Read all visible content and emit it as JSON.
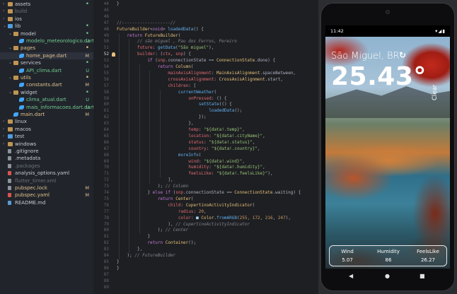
{
  "explorer": {
    "items": [
      {
        "label": "assets",
        "type": "folder",
        "depth": 0,
        "open": false,
        "status": "dot",
        "color": "green"
      },
      {
        "label": "build",
        "type": "folder",
        "depth": 0,
        "open": false,
        "status": "",
        "color": "ignored"
      },
      {
        "label": "ios",
        "type": "folder",
        "depth": 0,
        "open": false,
        "status": "",
        "color": "normal"
      },
      {
        "label": "lib",
        "type": "folder",
        "depth": 0,
        "open": true,
        "status": "dot",
        "color": "green"
      },
      {
        "label": "model",
        "type": "folder",
        "depth": 1,
        "open": true,
        "status": "dot",
        "color": "green"
      },
      {
        "label": "modelo_meteorologico.dart",
        "type": "dart",
        "depth": 2,
        "status": "U",
        "color": "untracked"
      },
      {
        "label": "pages",
        "type": "folder",
        "depth": 1,
        "open": true,
        "status": "dot",
        "color": "modified"
      },
      {
        "label": "home_page.dart",
        "type": "dart",
        "depth": 2,
        "status": "M",
        "color": "modified",
        "selected": true
      },
      {
        "label": "services",
        "type": "folder",
        "depth": 1,
        "open": true,
        "status": "dot",
        "color": "green"
      },
      {
        "label": "API_clima.dart",
        "type": "dart",
        "depth": 2,
        "status": "U",
        "color": "untracked"
      },
      {
        "label": "utils",
        "type": "folder",
        "depth": 1,
        "open": true,
        "status": "dot",
        "color": "modified"
      },
      {
        "label": "constants.dart",
        "type": "dart",
        "depth": 2,
        "status": "M",
        "color": "modified"
      },
      {
        "label": "widget",
        "type": "folder",
        "depth": 1,
        "open": true,
        "status": "dot",
        "color": "green"
      },
      {
        "label": "clima_atual.dart",
        "type": "dart",
        "depth": 2,
        "status": "U",
        "color": "untracked"
      },
      {
        "label": "mais_informacoes.dart.dart",
        "type": "dart",
        "depth": 2,
        "status": "U",
        "color": "untracked"
      },
      {
        "label": "main.dart",
        "type": "dart",
        "depth": 1,
        "status": "M",
        "color": "modified"
      },
      {
        "label": "linux",
        "type": "folder",
        "depth": 0,
        "open": false,
        "status": "",
        "color": "normal"
      },
      {
        "label": "macos",
        "type": "folder",
        "depth": 0,
        "open": false,
        "status": "",
        "color": "normal"
      },
      {
        "label": "test",
        "type": "folder",
        "depth": 0,
        "open": false,
        "status": "",
        "color": "normal"
      },
      {
        "label": "windows",
        "type": "folder",
        "depth": 0,
        "open": false,
        "status": "",
        "color": "normal"
      },
      {
        "label": ".gitignore",
        "type": "file",
        "depth": 0,
        "status": "",
        "color": "normal"
      },
      {
        "label": ".metadata",
        "type": "file",
        "depth": 0,
        "status": "",
        "color": "normal"
      },
      {
        "label": ".packages",
        "type": "file",
        "depth": 0,
        "status": "",
        "color": "ignored"
      },
      {
        "label": "analysis_options.yaml",
        "type": "yaml",
        "depth": 0,
        "status": "",
        "color": "normal"
      },
      {
        "label": "flutter_timer.xml",
        "type": "file",
        "depth": 0,
        "status": "",
        "color": "ignored"
      },
      {
        "label": "pubspec.lock",
        "type": "file",
        "depth": 0,
        "status": "M",
        "color": "modified"
      },
      {
        "label": "pubspec.yaml",
        "type": "yaml",
        "depth": 0,
        "status": "M",
        "color": "modified"
      },
      {
        "label": "README.md",
        "type": "md",
        "depth": 0,
        "status": "",
        "color": "normal"
      }
    ]
  },
  "editor": {
    "active_line": "52",
    "lines": [
      {
        "n": "44",
        "ind": 0,
        "t": [
          [
            "}",
            ""
          ]
        ]
      },
      {
        "n": "45",
        "ind": 0,
        "t": []
      },
      {
        "n": "46",
        "ind": 0,
        "t": []
      },
      {
        "n": "47",
        "ind": 0,
        "t": [
          [
            "//-------------------//",
            "cm"
          ]
        ]
      },
      {
        "n": "48",
        "ind": 0,
        "t": [
          [
            "FutureBuilder",
            "cls"
          ],
          [
            "<",
            ""
          ],
          [
            "void",
            "kw"
          ],
          [
            "> ",
            ""
          ],
          [
            "loadedData",
            "fn"
          ],
          [
            "() {",
            ""
          ]
        ]
      },
      {
        "n": "49",
        "ind": 1,
        "t": [
          [
            "return ",
            "kw"
          ],
          [
            "FutureBuilder",
            "cls"
          ],
          [
            "(",
            ""
          ]
        ]
      },
      {
        "n": "50",
        "ind": 2,
        "t": [
          [
            "// são miguel , Pau dos Ferros, Pereiro",
            "cm"
          ]
        ]
      },
      {
        "n": "51",
        "ind": 2,
        "t": [
          [
            "future",
            "prop"
          ],
          [
            ": ",
            ""
          ],
          [
            "getData",
            "fn"
          ],
          [
            "(",
            ""
          ],
          [
            "\"São miguel\"",
            "str"
          ],
          [
            "),",
            ""
          ]
        ]
      },
      {
        "n": "52",
        "ind": 2,
        "t": [
          [
            "builder",
            "prop"
          ],
          [
            ": (",
            ""
          ],
          [
            "ctx",
            "prop"
          ],
          [
            ", ",
            ""
          ],
          [
            "snp",
            "prop"
          ],
          [
            ") {",
            ""
          ]
        ],
        "bulb": true
      },
      {
        "n": "53",
        "ind": 3,
        "t": [
          [
            "if ",
            "kw"
          ],
          [
            "(",
            ""
          ],
          [
            "snp",
            "prop"
          ],
          [
            ".connectionState == ",
            ""
          ],
          [
            "ConnectionState",
            "cls"
          ],
          [
            ".done) {",
            ""
          ]
        ]
      },
      {
        "n": "54",
        "ind": 4,
        "t": [
          [
            "return ",
            "kw"
          ],
          [
            "Column",
            "cls"
          ],
          [
            "(",
            ""
          ]
        ]
      },
      {
        "n": "55",
        "ind": 5,
        "t": [
          [
            "mainAxisAlignment",
            "prop"
          ],
          [
            ": ",
            ""
          ],
          [
            "MainAxisAlignment",
            "cls"
          ],
          [
            ".spaceBetween,",
            ""
          ]
        ]
      },
      {
        "n": "56",
        "ind": 5,
        "t": [
          [
            "crossAxisAlignment",
            "prop"
          ],
          [
            ": ",
            ""
          ],
          [
            "CrossAxisAlignment",
            "cls"
          ],
          [
            ".start,",
            ""
          ]
        ]
      },
      {
        "n": "57",
        "ind": 5,
        "t": [
          [
            "children",
            "prop"
          ],
          [
            ": [",
            ""
          ]
        ]
      },
      {
        "n": "58",
        "ind": 6,
        "t": [
          [
            "currentWeather",
            "fn"
          ],
          [
            "(",
            ""
          ]
        ]
      },
      {
        "n": "59",
        "ind": 7,
        "t": [
          [
            "onPressed",
            "prop"
          ],
          [
            ": () {",
            ""
          ]
        ]
      },
      {
        "n": "60",
        "ind": 8,
        "t": [
          [
            "setState",
            "fn"
          ],
          [
            "(() {",
            ""
          ]
        ]
      },
      {
        "n": "61",
        "ind": 9,
        "t": [
          [
            "loadedData",
            "fn"
          ],
          [
            "();",
            ""
          ]
        ]
      },
      {
        "n": "62",
        "ind": 8,
        "t": [
          [
            "});",
            ""
          ]
        ]
      },
      {
        "n": "63",
        "ind": 7,
        "t": [
          [
            "},",
            ""
          ]
        ]
      },
      {
        "n": "64",
        "ind": 7,
        "t": [
          [
            "temp",
            "prop"
          ],
          [
            ": ",
            ""
          ],
          [
            "\"${data!.temp}\"",
            "str"
          ],
          [
            ",",
            ""
          ]
        ]
      },
      {
        "n": "65",
        "ind": 7,
        "t": [
          [
            "location",
            "prop"
          ],
          [
            ": ",
            ""
          ],
          [
            "\"${data!.cityName}\"",
            "str"
          ],
          [
            ",",
            ""
          ]
        ]
      },
      {
        "n": "66",
        "ind": 7,
        "t": [
          [
            "status",
            "prop"
          ],
          [
            ": ",
            ""
          ],
          [
            "\"${data!.status}\"",
            "str"
          ],
          [
            ",",
            ""
          ]
        ]
      },
      {
        "n": "67",
        "ind": 7,
        "t": [
          [
            "country",
            "prop"
          ],
          [
            ": ",
            ""
          ],
          [
            "\"${data!.country}\"",
            "str"
          ],
          [
            ",",
            ""
          ]
        ]
      },
      {
        "n": "68",
        "ind": 6,
        "t": [
          [
            "moreInfo",
            "fn"
          ],
          [
            "(",
            ""
          ]
        ]
      },
      {
        "n": "69",
        "ind": 7,
        "t": [
          [
            "wind",
            "prop"
          ],
          [
            ": ",
            ""
          ],
          [
            "\"${data!.wind}\"",
            "str"
          ],
          [
            ",",
            ""
          ]
        ]
      },
      {
        "n": "70",
        "ind": 7,
        "t": [
          [
            "humidity",
            "prop"
          ],
          [
            ": ",
            ""
          ],
          [
            "\"${data!.humidity}\"",
            "str"
          ],
          [
            ",",
            ""
          ]
        ]
      },
      {
        "n": "71",
        "ind": 7,
        "t": [
          [
            "feelsLike",
            "prop"
          ],
          [
            ": ",
            ""
          ],
          [
            "\"${data!.feelsLike}\"",
            "str"
          ],
          [
            "),",
            ""
          ]
        ]
      },
      {
        "n": "72",
        "ind": 5,
        "t": [
          [
            "],",
            ""
          ]
        ]
      },
      {
        "n": "73",
        "ind": 4,
        "t": [
          [
            "); ",
            ""
          ],
          [
            "// Column",
            "cm"
          ]
        ]
      },
      {
        "n": "74",
        "ind": 3,
        "t": [
          [
            "} ",
            ""
          ],
          [
            "else if ",
            "kw"
          ],
          [
            "(",
            ""
          ],
          [
            "snp",
            "prop"
          ],
          [
            ".connectionState == ",
            ""
          ],
          [
            "ConnectionState",
            "cls"
          ],
          [
            ".waiting) {",
            ""
          ]
        ]
      },
      {
        "n": "75",
        "ind": 4,
        "t": [
          [
            "return ",
            "kw"
          ],
          [
            "Center",
            "cls"
          ],
          [
            "(",
            ""
          ]
        ]
      },
      {
        "n": "76",
        "ind": 5,
        "t": [
          [
            "child",
            "prop"
          ],
          [
            ": ",
            ""
          ],
          [
            "CupertinoActivityIndicator",
            "cls"
          ],
          [
            "(",
            ""
          ]
        ]
      },
      {
        "n": "77",
        "ind": 6,
        "t": [
          [
            "radius",
            "prop"
          ],
          [
            ": ",
            ""
          ],
          [
            "20",
            "num"
          ],
          [
            ",",
            ""
          ]
        ]
      },
      {
        "n": "78",
        "ind": 6,
        "t": [
          [
            "color",
            "prop"
          ],
          [
            ": ",
            ""
          ],
          [
            "■ ",
            "sw"
          ],
          [
            "Color",
            "cls"
          ],
          [
            ".",
            ""
          ],
          [
            "fromARGB",
            "fn"
          ],
          [
            "(",
            ""
          ],
          [
            "255",
            "num"
          ],
          [
            ", ",
            ""
          ],
          [
            "172",
            "num"
          ],
          [
            ", ",
            ""
          ],
          [
            "216",
            "num"
          ],
          [
            ", ",
            ""
          ],
          [
            "247",
            "num"
          ],
          [
            "),",
            ""
          ]
        ]
      },
      {
        "n": "79",
        "ind": 5,
        "t": [
          [
            "), ",
            ""
          ],
          [
            "// CupertinoActivityIndicator",
            "cm"
          ]
        ]
      },
      {
        "n": "80",
        "ind": 4,
        "t": [
          [
            "); ",
            ""
          ],
          [
            "// Center",
            "cm"
          ]
        ]
      },
      {
        "n": "81",
        "ind": 3,
        "t": [
          [
            "}",
            ""
          ]
        ]
      },
      {
        "n": "82",
        "ind": 3,
        "t": [
          [
            "return ",
            "kw"
          ],
          [
            "Container",
            "cls"
          ],
          [
            "();",
            ""
          ]
        ]
      },
      {
        "n": "83",
        "ind": 2,
        "t": [
          [
            "},",
            ""
          ]
        ]
      },
      {
        "n": "84",
        "ind": 1,
        "t": [
          [
            "); ",
            ""
          ],
          [
            "// FutureBuilder",
            "cm"
          ]
        ]
      },
      {
        "n": "85",
        "ind": 0,
        "t": [
          [
            "}",
            ""
          ]
        ]
      },
      {
        "n": "86",
        "ind": 0,
        "t": [
          [
            "}",
            ""
          ]
        ]
      },
      {
        "n": "87",
        "ind": 0,
        "t": []
      },
      {
        "n": "88",
        "ind": 0,
        "t": []
      },
      {
        "n": "89",
        "ind": 0,
        "t": []
      }
    ]
  },
  "phone": {
    "time": "11:42",
    "status_icons": "▾◢▮",
    "city": "São Miguel, BR",
    "refresh_icon": "↻",
    "temp": "25.43°",
    "status": "Clear",
    "info": [
      {
        "label": "Wind",
        "value": "5.07"
      },
      {
        "label": "Humidity",
        "value": "86"
      },
      {
        "label": "FeelsLike",
        "value": "26.27"
      }
    ],
    "nav": {
      "back": "◀",
      "home": "●",
      "recents": "■"
    }
  },
  "colors": {
    "swatch": "#acd8f7"
  }
}
